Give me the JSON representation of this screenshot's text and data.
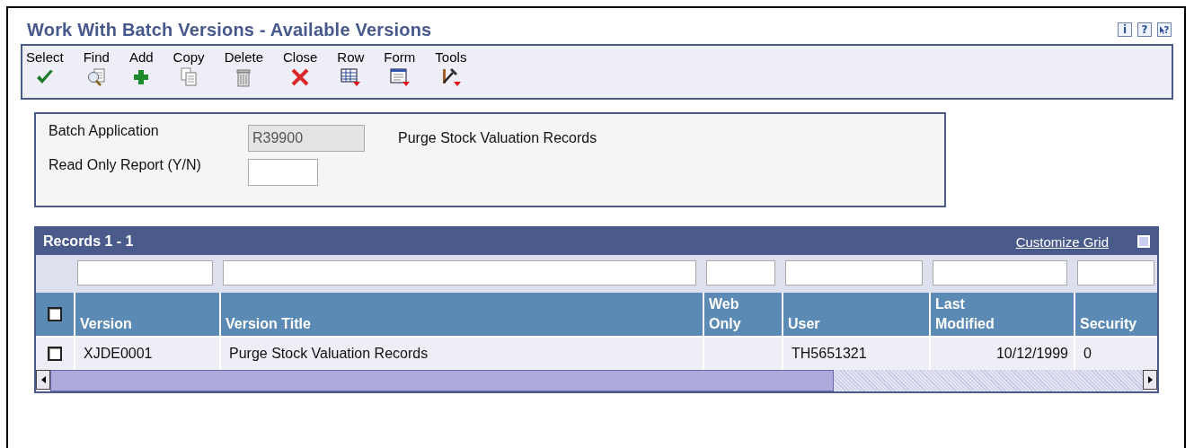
{
  "window": {
    "title": "Work With Batch Versions - Available Versions",
    "help_buttons": [
      {
        "kind": "info",
        "label": "i"
      },
      {
        "kind": "help",
        "label": "?"
      },
      {
        "kind": "whats-this",
        "label": "?"
      }
    ]
  },
  "toolbar": [
    {
      "label": "Select"
    },
    {
      "label": "Find"
    },
    {
      "label": "Add"
    },
    {
      "label": "Copy"
    },
    {
      "label": "Delete"
    },
    {
      "label": "Close"
    },
    {
      "label": "Row"
    },
    {
      "label": "Form"
    },
    {
      "label": "Tools"
    }
  ],
  "form": {
    "fields": [
      {
        "label": "Batch Application",
        "value": "R39900",
        "disabled": true,
        "description": "Purge Stock Valuation Records"
      },
      {
        "label": "Read Only Report (Y/N)",
        "disabled": false
      }
    ]
  },
  "grid": {
    "title": "Records 1 - 1",
    "customize_link": "Customize Grid",
    "select_all_checked": false,
    "columns": [
      {
        "label": "Version"
      },
      {
        "label": "Version Title"
      },
      {
        "label": "Web Only"
      },
      {
        "label": "User"
      },
      {
        "label": "Last Modified"
      },
      {
        "label": "Security"
      }
    ],
    "rows": [
      {
        "selected": false,
        "cells": [
          "XJDE0001",
          "Purge Stock Valuation Records",
          "",
          "TH5651321",
          "10/12/1999",
          "0"
        ]
      }
    ]
  }
}
